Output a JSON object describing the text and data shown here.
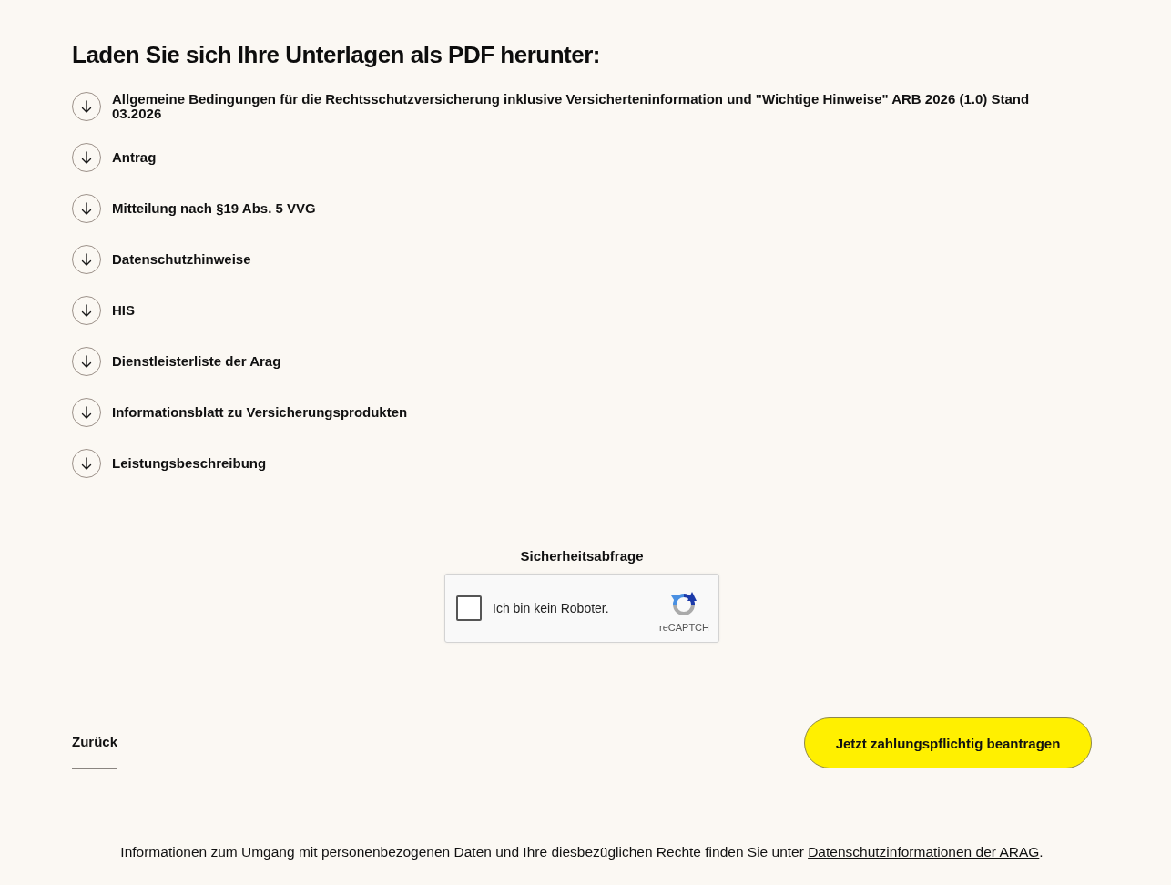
{
  "heading": "Laden Sie sich Ihre Unterlagen als PDF herunter:",
  "downloads": [
    {
      "label": "Allgemeine Bedingungen für die Rechtsschutzversicherung inklusive Versicherteninformation und \"Wichtige Hinweise\" ARB 2026 (1.0) Stand 03.2026"
    },
    {
      "label": "Antrag"
    },
    {
      "label": "Mitteilung nach §19 Abs. 5 VVG"
    },
    {
      "label": "Datenschutzhinweise"
    },
    {
      "label": "HIS"
    },
    {
      "label": "Dienstleisterliste der Arag"
    },
    {
      "label": "Informationsblatt zu Versicherungsprodukten"
    },
    {
      "label": "Leistungsbeschreibung"
    }
  ],
  "captcha": {
    "title": "Sicherheitsabfrage",
    "checkbox_label": "Ich bin kein Roboter.",
    "checked": false,
    "brand": "reCAPTCH"
  },
  "back_link": "Zurück",
  "submit_button": "Jetzt zahlungspflichtig beantragen",
  "footer": {
    "text": "Informationen zum Umgang mit personenbezogenen Daten und Ihre diesbezüglichen Rechte finden Sie unter",
    "link": "Datenschutzinformationen der ARAG",
    "end": "."
  }
}
